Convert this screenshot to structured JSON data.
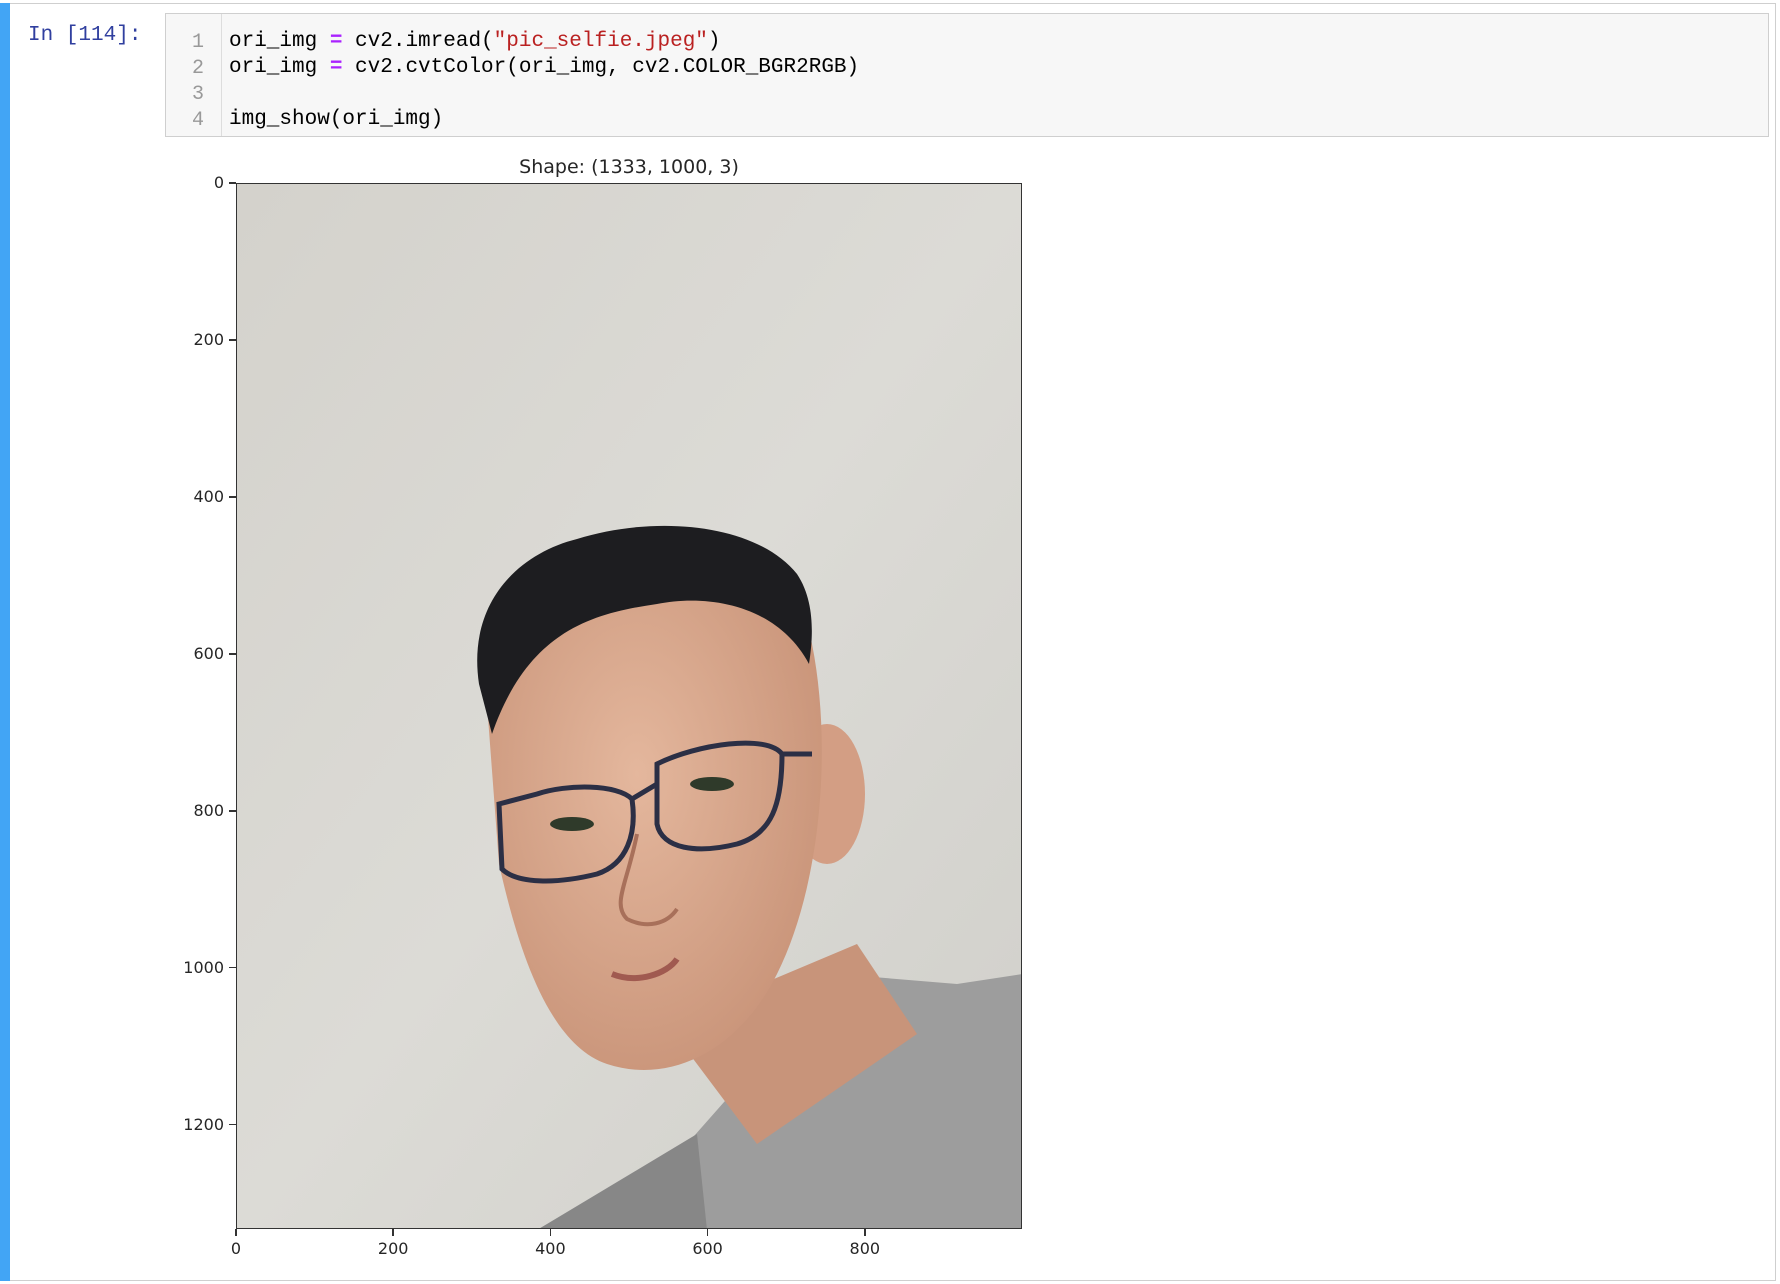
{
  "cell": {
    "prompt": "In [114]:",
    "lines": [
      {
        "no": "1",
        "segments": [
          {
            "text": "ori_img ",
            "cls": ""
          },
          {
            "text": "=",
            "cls": "tok-op"
          },
          {
            "text": " cv2.imread(",
            "cls": ""
          },
          {
            "text": "\"pic_selfie.jpeg\"",
            "cls": "tok-str"
          },
          {
            "text": ")",
            "cls": ""
          }
        ]
      },
      {
        "no": "2",
        "segments": [
          {
            "text": "ori_img ",
            "cls": ""
          },
          {
            "text": "=",
            "cls": "tok-op"
          },
          {
            "text": " cv2.cvtColor(ori_img, cv2.COLOR_BGR2RGB)",
            "cls": ""
          }
        ]
      },
      {
        "no": "3",
        "segments": []
      },
      {
        "no": "4",
        "segments": [
          {
            "text": "img_show(ori_img)",
            "cls": ""
          }
        ]
      }
    ]
  },
  "output": {
    "title": "Shape: (1333, 1000, 3)",
    "image_shape": {
      "height": 1333,
      "width": 1000,
      "channels": 3
    },
    "y_ticks": [
      {
        "value": 0,
        "label": "0"
      },
      {
        "value": 200,
        "label": "200"
      },
      {
        "value": 400,
        "label": "400"
      },
      {
        "value": 600,
        "label": "600"
      },
      {
        "value": 800,
        "label": "800"
      },
      {
        "value": 1000,
        "label": "1000"
      },
      {
        "value": 1200,
        "label": "1200"
      }
    ],
    "x_ticks": [
      {
        "value": 0,
        "label": "0"
      },
      {
        "value": 200,
        "label": "200"
      },
      {
        "value": 400,
        "label": "400"
      },
      {
        "value": 600,
        "label": "600"
      },
      {
        "value": 800,
        "label": "800"
      }
    ]
  },
  "colors": {
    "cell_bar": "#42a5f5",
    "prompt": "#303f9f",
    "operator": "#aa22ff",
    "string": "#ba2121",
    "wall": "#d9d8d2",
    "hair": "#1c1c1e",
    "skin": "#d9a98f",
    "shirt": "#9b9b9b",
    "glasses": "#2b2f45"
  }
}
